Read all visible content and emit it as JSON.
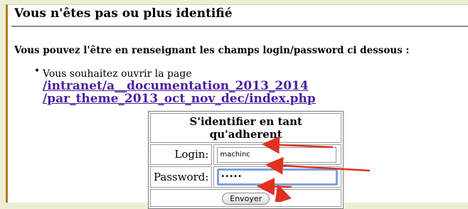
{
  "page": {
    "title": "Vous n'êtes pas ou plus identifié",
    "subtitle": "Vous pouvez l'être en renseignant les champs login/password ci dessous :",
    "item_prefix": "Vous souhaitez ouvrir la page ",
    "item_link": "/intranet/a__documentation_2013_2014 /par_theme_2013_oct_nov_dec/index.php"
  },
  "login_form": {
    "header": "S'identifier en tant qu'adherent",
    "login_label": "Login:",
    "login_value": "machinc",
    "password_label": "Password:",
    "password_value": "•••••",
    "submit_label": "Envoyer"
  },
  "colors": {
    "arrow": "#e0301e",
    "link": "#4b1ea1",
    "background": "#ecefd6",
    "sidebar_border": "#b37a1c"
  }
}
